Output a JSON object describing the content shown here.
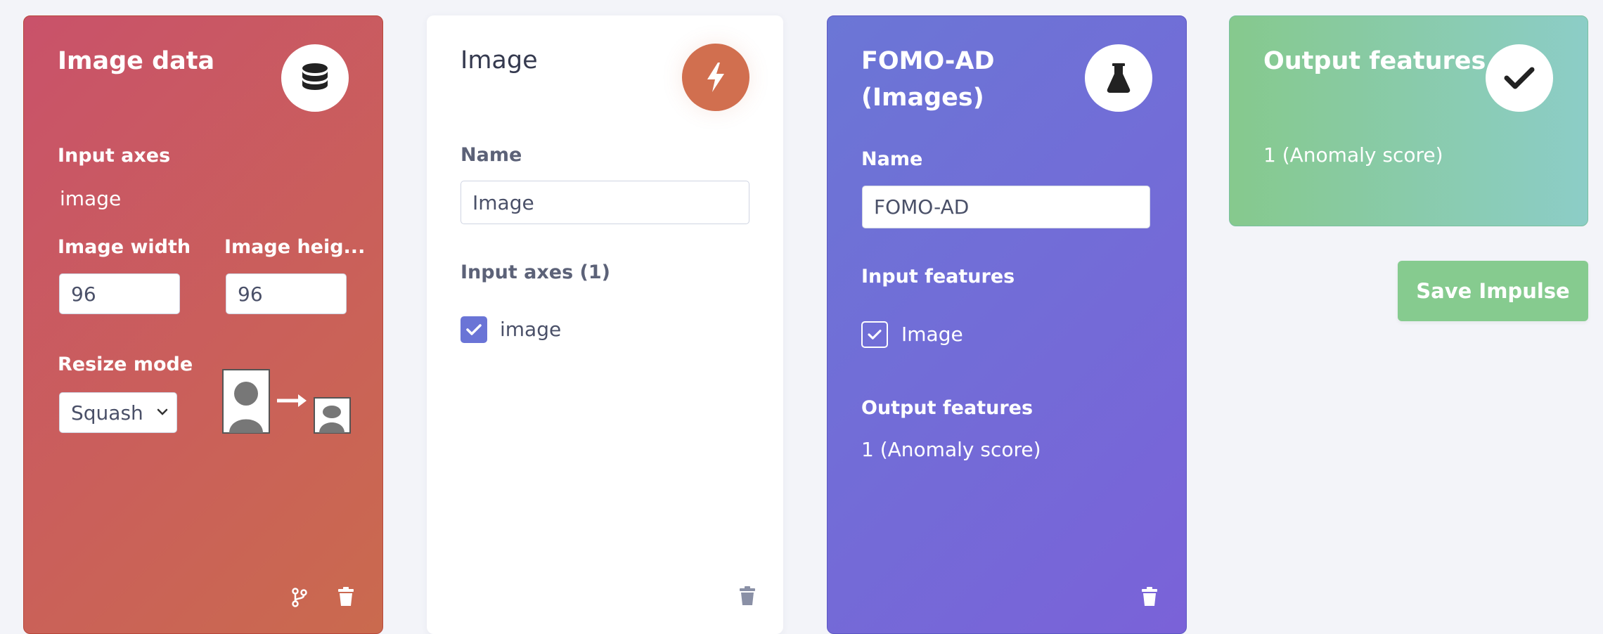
{
  "image_data_card": {
    "title": "Image data",
    "icon": "database-icon",
    "input_axes_label": "Input axes",
    "input_axes_value": "image",
    "width_label": "Image width",
    "width_value": "96",
    "height_label": "Image heig...",
    "height_value": "96",
    "resize_label": "Resize mode",
    "resize_value": "Squash"
  },
  "image_card": {
    "title": "Image",
    "icon": "bolt-icon",
    "name_label": "Name",
    "name_value": "Image",
    "axes_label": "Input axes (1)",
    "axes_items": [
      {
        "label": "image",
        "checked": true
      }
    ]
  },
  "fomo_card": {
    "title_line1": "FOMO-AD",
    "title_line2": "(Images)",
    "icon": "flask-icon",
    "name_label": "Name",
    "name_value": "FOMO-AD",
    "input_features_label": "Input features",
    "input_features_items": [
      {
        "label": "Image",
        "checked": true
      }
    ],
    "output_features_label": "Output features",
    "output_features_value": "1 (Anomaly score)"
  },
  "output_card": {
    "title": "Output features",
    "icon": "check-icon",
    "value": "1 (Anomaly score)"
  },
  "save_button": {
    "label": "Save Impulse"
  },
  "colors": {
    "image_data_bg": "#c95c5a",
    "fomo_bg": "#7069d7",
    "output_bg": "#88cba6",
    "accent": "#6a74d6",
    "save_button": "#86cb8f",
    "bolt_circle": "#d16f4f"
  }
}
